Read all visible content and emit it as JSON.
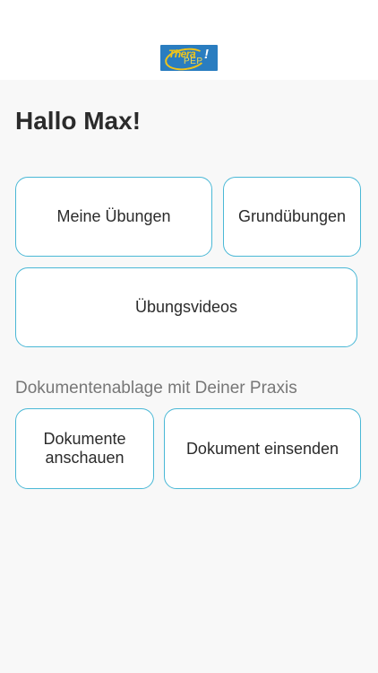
{
  "logo": {
    "line1": "Thera",
    "line2": "PEP",
    "mark": "!",
    "colors": {
      "background": "#2a7dc0",
      "accent": "#f0c419"
    }
  },
  "greeting": "Hallo Max!",
  "buttons": {
    "my_exercises": "Meine Übungen",
    "basic_exercises": "Grundübungen",
    "exercise_videos": "Übungsvideos"
  },
  "documents": {
    "section_title": "Dokumentenablage mit Deiner Praxis",
    "view_line1": "Dokumente",
    "view_line2": "anschauen",
    "send": "Dokument einsenden"
  },
  "colors": {
    "card_border": "#4ab8d6",
    "page_background": "#f8f8f8"
  }
}
